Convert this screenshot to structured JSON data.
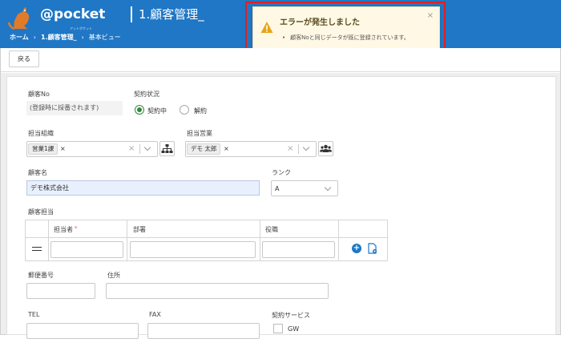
{
  "header": {
    "logo_text": "@pocket",
    "logo_sub": "アットポケット",
    "page_title": "1.顧客管理_",
    "breadcrumb": [
      "ホーム",
      "1.顧客管理_",
      "基本ビュー"
    ],
    "bar_color": "#1f77c5"
  },
  "alert": {
    "title": "エラーが発生しました",
    "message": "顧客Noと同じデータが既に登録されています。",
    "close": "×",
    "icon": "warning-icon",
    "accent": "#e8a317"
  },
  "toolbar": {
    "back_label": "戻る"
  },
  "form": {
    "customer_no_label": "顧客No",
    "customer_no_value": "(登録時に採番されます)",
    "contract_status_label": "契約状況",
    "contract_options": [
      "契約中",
      "解約"
    ],
    "contract_selected": "契約中",
    "org_label": "担当組織",
    "org_tag": "営業1課",
    "staff_label": "担当営業",
    "staff_tag": "デモ 太郎",
    "tag_remove": "×",
    "clear_symbol": "×",
    "customer_name_label": "顧客名",
    "customer_name_value": "デモ株式会社",
    "rank_label": "ランク",
    "rank_value": "A",
    "contact_label": "顧客担当",
    "table_headers": [
      "担当者",
      "部署",
      "役職"
    ],
    "required_mark": "*",
    "zip_label": "郵便番号",
    "address_label": "住所",
    "tel_label": "TEL",
    "fax_label": "FAX",
    "service_label": "契約サービス",
    "service_options": [
      "GW"
    ]
  }
}
